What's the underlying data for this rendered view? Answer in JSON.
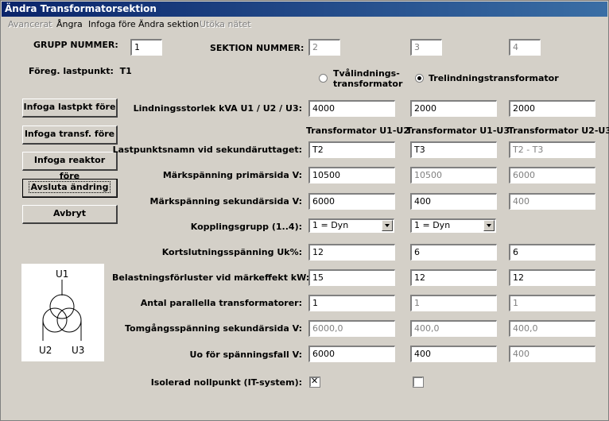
{
  "window": {
    "title": "Ändra Transformatorsektion"
  },
  "menu": [
    {
      "label": "Avancerat",
      "disabled": true
    },
    {
      "label": "Ångra",
      "disabled": false
    },
    {
      "label": "Infoga före",
      "disabled": false
    },
    {
      "label": "Ändra sektion",
      "disabled": false
    },
    {
      "label": "Utöka nätet",
      "disabled": true
    }
  ],
  "header": {
    "grupp_label": "GRUPP NUMMER:",
    "grupp_value": "1",
    "sektion_label": "SEKTION NUMMER:",
    "sektion_values": [
      "2",
      "3",
      "4"
    ],
    "foreg_label": "Föreg. lastpunkt:",
    "foreg_value": "T1"
  },
  "type_radio": {
    "two_line1": "Tvålindnings-",
    "two_line2": "transformator",
    "three": "Trelindningstransformator",
    "selected": "three"
  },
  "buttons": {
    "insert_load": "Infoga lastpkt före",
    "insert_transf": "Infoga transf. före",
    "insert_reactor": "Infoga reaktor före",
    "finish": "Avsluta ändring",
    "cancel": "Avbryt"
  },
  "size": {
    "label": "Lindningsstorlek kVA  U1 / U2 / U3:",
    "values": [
      "4000",
      "2000",
      "2000"
    ]
  },
  "columns": [
    "Transformator U1-U2",
    "Transformator U1-U3",
    "Transformator U2-U3"
  ],
  "rows": {
    "load_name": {
      "label": "Lastpunktsnamn vid sekundäruttaget:",
      "values": [
        "T2",
        "T3",
        "T2 - T3"
      ]
    },
    "primary_voltage": {
      "label": "Märkspänning primärsida V:",
      "values": [
        "10500",
        "10500",
        "6000"
      ]
    },
    "secondary_voltage": {
      "label": "Märkspänning sekundärsida V:",
      "values": [
        "6000",
        "400",
        "400"
      ]
    },
    "vector_group": {
      "label": "Kopplingsgrupp (1..4):",
      "values": [
        "1 = Dyn",
        "1 = Dyn"
      ]
    },
    "short_circuit": {
      "label": "Kortslutningsspänning Uk%:",
      "values": [
        "12",
        "6",
        "6"
      ]
    },
    "load_losses": {
      "label": "Belastningsförluster vid märkeffekt kW:",
      "values": [
        "15",
        "12",
        "12"
      ]
    },
    "parallel": {
      "label": "Antal parallella transformatorer:",
      "values": [
        "1",
        "1",
        "1"
      ]
    },
    "no_load_voltage": {
      "label": "Tomgångsspänning sekundärsida V:",
      "values": [
        "6000,0",
        "400,0",
        "400,0"
      ]
    },
    "uo_drop": {
      "label": "Uo för spänningsfall V:",
      "values": [
        "6000",
        "400",
        "400"
      ]
    },
    "isolated": {
      "label": "Isolerad nollpunkt (IT-system):",
      "checked": [
        true,
        false
      ]
    }
  },
  "diagram": {
    "u1": "U1",
    "u2": "U2",
    "u3": "U3"
  }
}
